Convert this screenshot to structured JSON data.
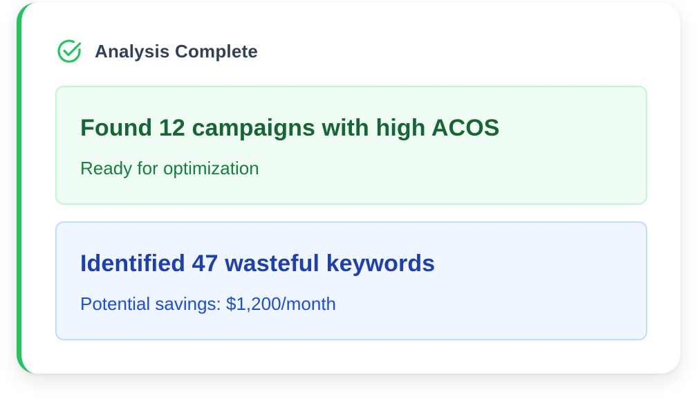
{
  "header": {
    "title": "Analysis Complete",
    "icon": "check-circle-icon"
  },
  "results": [
    {
      "title": "Found 12 campaigns with high ACOS",
      "subtitle": "Ready for optimization",
      "color": "#166534"
    },
    {
      "title": "Identified 47 wasteful keywords",
      "subtitle": "Potential savings: $1,200/month",
      "color": "#1e40af"
    }
  ],
  "colors": {
    "accent": "#22c55e",
    "success_bg": "#f0fdf4",
    "info_bg": "#eff6ff"
  }
}
